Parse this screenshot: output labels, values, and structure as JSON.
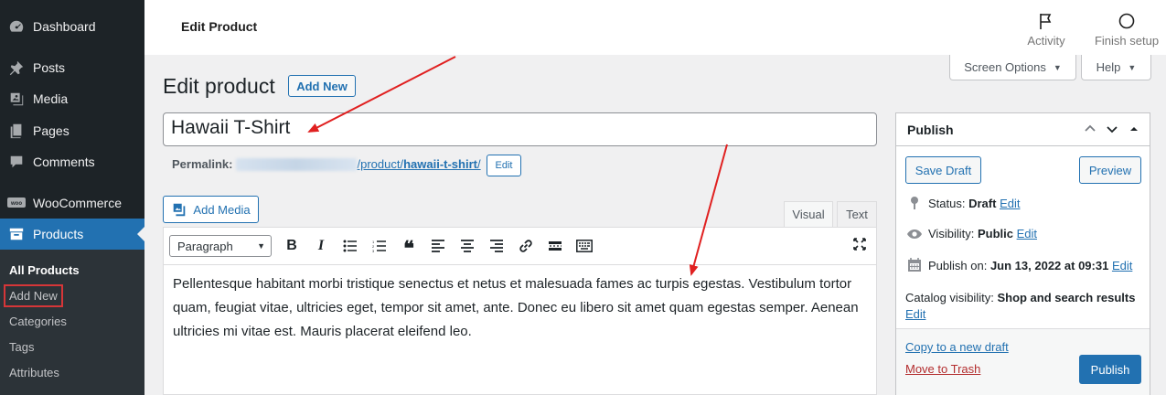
{
  "sidebar": {
    "items": [
      {
        "label": "Dashboard",
        "icon": "dashboard-icon"
      },
      {
        "label": "Posts",
        "icon": "pin-icon"
      },
      {
        "label": "Media",
        "icon": "media-icon"
      },
      {
        "label": "Pages",
        "icon": "pages-icon"
      },
      {
        "label": "Comments",
        "icon": "comment-icon"
      },
      {
        "label": "WooCommerce",
        "icon": "woocommerce-icon"
      },
      {
        "label": "Products",
        "icon": "archive-icon"
      }
    ],
    "submenu": [
      "All Products",
      "Add New",
      "Categories",
      "Tags",
      "Attributes"
    ]
  },
  "topbar": {
    "title": "Edit Product",
    "activity": "Activity",
    "finish_setup": "Finish setup"
  },
  "screen_options": "Screen Options",
  "help": "Help",
  "page": {
    "heading": "Edit product",
    "add_new": "Add New",
    "title_value": "Hawaii T-Shirt",
    "permalink_label": "Permalink:",
    "permalink_path": "/product/",
    "permalink_slug": "hawaii-t-shirt",
    "permalink_trail": "/",
    "permalink_edit": "Edit"
  },
  "editor": {
    "add_media": "Add Media",
    "tab_visual": "Visual",
    "tab_text": "Text",
    "format": "Paragraph",
    "content": "Pellentesque habitant morbi tristique senectus et netus et malesuada fames ac turpis egestas. Vestibulum tortor quam, feugiat vitae, ultricies eget, tempor sit amet, ante. Donec eu libero sit amet quam egestas semper. Aenean ultricies mi vitae est. Mauris placerat eleifend leo."
  },
  "publish": {
    "title": "Publish",
    "save_draft": "Save Draft",
    "preview": "Preview",
    "status_label": "Status:",
    "status_value": "Draft",
    "visibility_label": "Visibility:",
    "visibility_value": "Public",
    "publish_on_label": "Publish on:",
    "publish_on_value": "Jun 13, 2022 at 09:31",
    "edit": "Edit",
    "catalog_label": "Catalog visibility:",
    "catalog_value": "Shop and search results",
    "copy_draft": "Copy to a new draft",
    "trash": "Move to Trash",
    "publish_button": "Publish"
  },
  "colors": {
    "sidebar_bg": "#1d2327",
    "accent": "#2271b1",
    "annotation": "#e02020"
  }
}
